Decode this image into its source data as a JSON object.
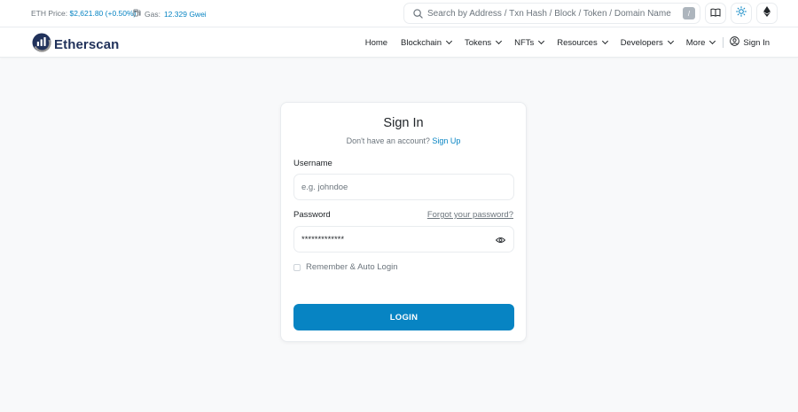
{
  "topbar": {
    "eth_price_label": "ETH Price:",
    "eth_price_value": "$2,621.80 (+0.50%)",
    "gas_label": "Gas:",
    "gas_value": "12.329 Gwei",
    "search_placeholder": "Search by Address / Txn Hash / Block / Token / Domain Name",
    "search_shortcut": "/",
    "icons": [
      "search-icon",
      "book-icon",
      "sun-icon",
      "ethereum-icon"
    ]
  },
  "nav": {
    "logo_text": "Etherscan",
    "items": [
      {
        "label": "Home",
        "dropdown": false
      },
      {
        "label": "Blockchain",
        "dropdown": true
      },
      {
        "label": "Tokens",
        "dropdown": true
      },
      {
        "label": "NFTs",
        "dropdown": true
      },
      {
        "label": "Resources",
        "dropdown": true
      },
      {
        "label": "Developers",
        "dropdown": true
      },
      {
        "label": "More",
        "dropdown": true
      }
    ],
    "sign_in": "Sign In"
  },
  "signin": {
    "title": "Sign In",
    "no_account_text": "Don't have an account?",
    "sign_up_link": "Sign Up",
    "username_label": "Username",
    "username_placeholder": "e.g. johndoe",
    "password_label": "Password",
    "forgot_link": "Forgot your password?",
    "password_value": "*************",
    "remember_label": "Remember & Auto Login",
    "login_button": "LOGIN"
  },
  "colors": {
    "accent": "#0784c3",
    "logo_navy": "#21325b",
    "background": "#f8f9fa"
  }
}
